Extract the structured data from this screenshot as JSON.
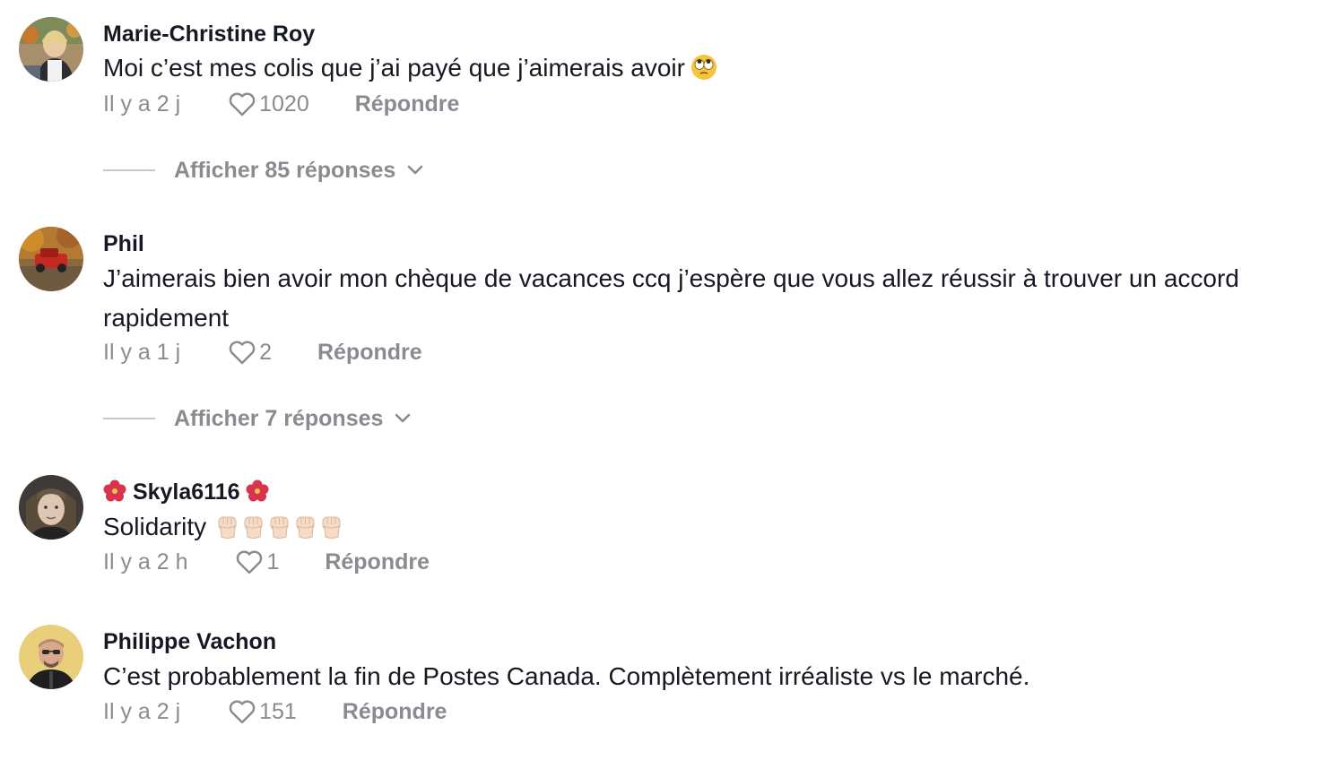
{
  "comments": [
    {
      "username": "Marie-Christine Roy",
      "text": "Moi c’est mes colis que j’ai payé que j’aimerais avoir",
      "text_emoji": "face-with-rolling-eyes",
      "time": "Il y a 2 j",
      "likes": "1020",
      "reply_label": "Répondre",
      "view_replies": "Afficher 85 réponses"
    },
    {
      "username": "Phil",
      "text": "J’aimerais bien avoir mon chèque de vacances ccq j’espère que vous allez réussir à trouver un accord rapidement",
      "time": "Il y a 1 j",
      "likes": "2",
      "reply_label": "Répondre",
      "view_replies": "Afficher 7 réponses"
    },
    {
      "username": "Skyla6116",
      "username_emoji": "hibiscus",
      "text": "Solidarity",
      "text_emoji": "raised-fist x5",
      "time": "Il y a 2 h",
      "likes": "1",
      "reply_label": "Répondre"
    },
    {
      "username": "Philippe Vachon",
      "text": "C’est probablement la fin de Postes Canada. Complètement irréaliste vs le marché.",
      "time": "Il y a 2 j",
      "likes": "151",
      "reply_label": "Répondre"
    }
  ],
  "icons": {
    "like": "heart-outline-icon",
    "expand": "chevron-down-icon"
  },
  "colors": {
    "text": "#161823",
    "muted": "#8a8b91",
    "divider": "#c7c8cc"
  }
}
